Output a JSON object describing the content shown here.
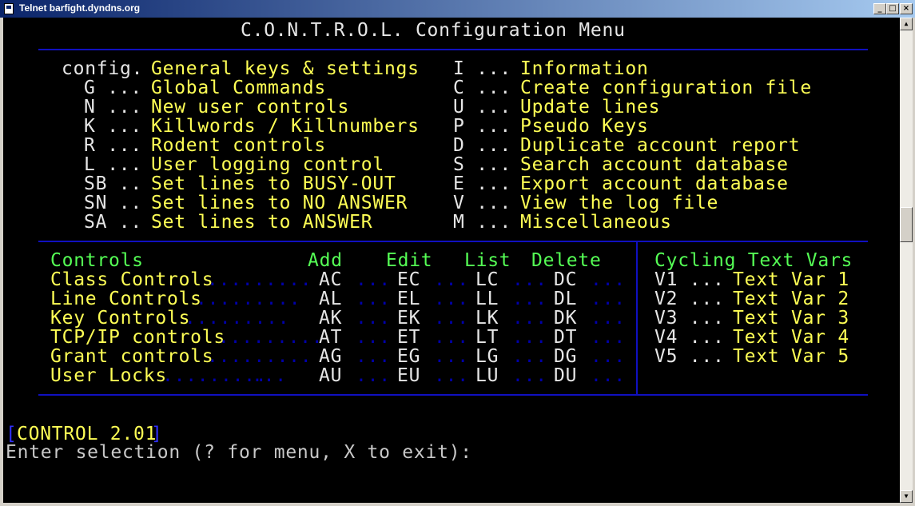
{
  "window": {
    "title": "Telnet barfight.dyndns.org",
    "minimize": "_",
    "maximize": "□",
    "close": "×"
  },
  "header": {
    "title": "C.O.N.T.R.O.L. Configuration Menu"
  },
  "menu_left": [
    {
      "key": "config.",
      "label": "General keys & settings"
    },
    {
      "key": "G ...",
      "label": "Global Commands"
    },
    {
      "key": "N ...",
      "label": "New user controls"
    },
    {
      "key": "K ...",
      "label": "Killwords / Killnumbers"
    },
    {
      "key": "R ...",
      "label": "Rodent controls"
    },
    {
      "key": "L ...",
      "label": "User logging control"
    },
    {
      "key": "SB ..",
      "label": "Set lines to BUSY-OUT"
    },
    {
      "key": "SN ..",
      "label": "Set lines to NO ANSWER"
    },
    {
      "key": "SA ..",
      "label": "Set lines to ANSWER"
    }
  ],
  "menu_right": [
    {
      "key": "I ...",
      "label": "Information"
    },
    {
      "key": "C ...",
      "label": "Create configuration file"
    },
    {
      "key": "U ...",
      "label": "Update lines"
    },
    {
      "key": "P ...",
      "label": "Pseudo Keys"
    },
    {
      "key": "D ...",
      "label": "Duplicate account report"
    },
    {
      "key": "S ...",
      "label": "Search account database"
    },
    {
      "key": "E ...",
      "label": "Export account database"
    },
    {
      "key": "V ...",
      "label": "View the log file"
    },
    {
      "key": "M ...",
      "label": "Miscellaneous"
    }
  ],
  "controls": {
    "headers": {
      "name": "Controls",
      "add": "Add",
      "edit": "Edit",
      "list": "List",
      "delete": "Delete"
    },
    "leader": ".........",
    "sep": "...",
    "rows": [
      {
        "name": "Class Controls",
        "add": "AC",
        "edit": "EC",
        "list": "LC",
        "delete": "DC"
      },
      {
        "name": "Line Controls",
        "add": "AL",
        "edit": "EL",
        "list": "LL",
        "delete": "DL"
      },
      {
        "name": "Key Controls",
        "add": "AK",
        "edit": "EK",
        "list": "LK",
        "delete": "DK"
      },
      {
        "name": "TCP/IP controls",
        "add": "AT",
        "edit": "ET",
        "list": "LT",
        "delete": "DT"
      },
      {
        "name": "Grant controls",
        "add": "AG",
        "edit": "EG",
        "list": "LG",
        "delete": "DG"
      },
      {
        "name": "User Locks",
        "add": "AU",
        "edit": "EU",
        "list": "LU",
        "delete": "DU"
      }
    ]
  },
  "cycling": {
    "header": "Cycling Text Vars",
    "items": [
      {
        "key": "V1 ...",
        "label": "Text Var 1"
      },
      {
        "key": "V2 ...",
        "label": "Text Var 2"
      },
      {
        "key": "V3 ...",
        "label": "Text Var 3"
      },
      {
        "key": "V4 ...",
        "label": "Text Var 4"
      },
      {
        "key": "V5 ...",
        "label": "Text Var 5"
      }
    ]
  },
  "status": {
    "open": "[",
    "text": "CONTROL 2.01",
    "close": "]"
  },
  "prompt": "Enter selection (? for menu, X to exit):"
}
